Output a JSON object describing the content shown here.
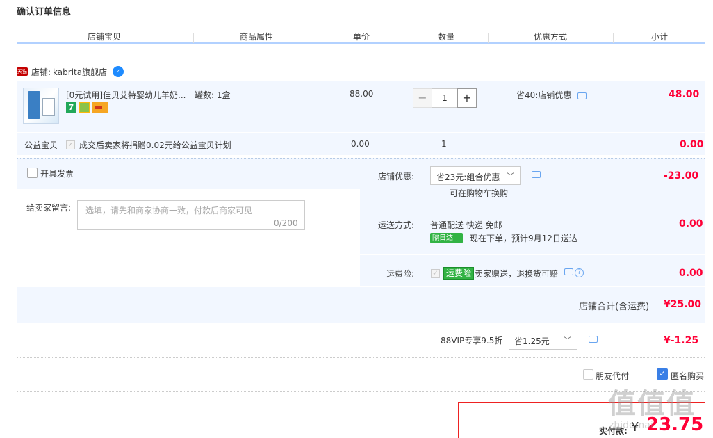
{
  "page": {
    "title": "确认订单信息"
  },
  "columns": [
    "店铺宝贝",
    "商品属性",
    "单价",
    "数量",
    "优惠方式",
    "小计"
  ],
  "shop": {
    "badge": "天猫",
    "label": "店铺:",
    "name": "kabrita旗舰店"
  },
  "item": {
    "title": "[0元试用]佳贝艾特婴幼儿羊奶...",
    "attribute": "罐数: 1盒",
    "unit_price": "88.00",
    "quantity": "1",
    "minus": "−",
    "plus": "+",
    "discount": "省40:店铺优惠",
    "subtotal": "48.00",
    "badge_7": "7"
  },
  "charity": {
    "label": "公益宝贝",
    "text": "成交后卖家将捐赠0.02元给公益宝贝计划",
    "price": "0.00",
    "quantity": "1",
    "subtotal": "0.00"
  },
  "invoice": {
    "label": "开具发票"
  },
  "memo": {
    "label": "给卖家留言:",
    "placeholder": "选填，请先和商家协商一致，付款后商家可见",
    "count": "0/200"
  },
  "promo": {
    "label": "店铺优惠:",
    "selected": "省23元:组合优惠",
    "sub": "可在购物车换购",
    "amount": "-23.00"
  },
  "shipping": {
    "label": "运送方式:",
    "method": "普通配送 快递 免邮",
    "badge": "隔日达",
    "eta": "现在下单，预计9月12日送达",
    "amount": "0.00"
  },
  "insurance": {
    "label": "运费险:",
    "badge": "运费险",
    "text": "卖家赠送，退换货可赔",
    "amount": "0.00"
  },
  "shop_total": {
    "label": "店铺合计(含运费)",
    "amount": "¥25.00"
  },
  "vip": {
    "label": "88VIP专享9.5折",
    "selected": "省1.25元",
    "amount": "¥-1.25"
  },
  "options": {
    "friend_pay": "朋友代付",
    "anonymous": "匿名购买"
  },
  "payment": {
    "label": "实付款:",
    "currency": "¥",
    "amount": "23.75"
  },
  "watermark": {
    "text": "值值值",
    "url": "zhidemai"
  },
  "colors": {
    "accent": "#ff0036",
    "panel": "#f2f7ff",
    "header_line": "#b2d1ff"
  }
}
